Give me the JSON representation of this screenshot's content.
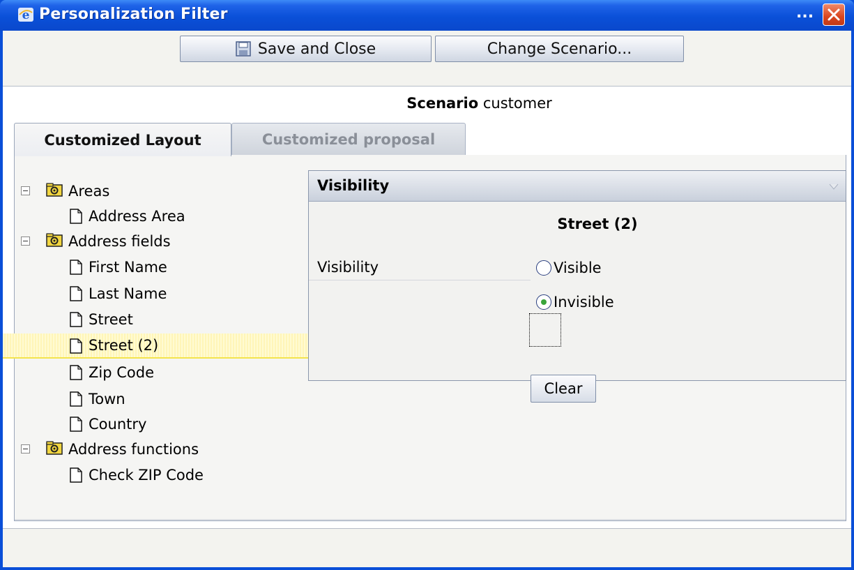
{
  "window": {
    "title": "Personalization Filter",
    "title_dots": "...",
    "colors": {
      "titlebar": "#0a50d8",
      "close": "#d9461f",
      "selection": "#fff5b8"
    }
  },
  "toolbar": {
    "save_label": "Save and Close",
    "change_label": "Change Scenario..."
  },
  "scenario": {
    "label": "Scenario",
    "value": "customer"
  },
  "tabs": [
    {
      "label": "Customized Layout",
      "active": true
    },
    {
      "label": "Customized proposal",
      "active": false
    }
  ],
  "tree": {
    "items": [
      {
        "label": "Areas",
        "type": "folder",
        "expanded": true
      },
      {
        "label": "Address Area",
        "type": "document"
      },
      {
        "label": "Address fields",
        "type": "folder",
        "expanded": true
      },
      {
        "label": "First Name",
        "type": "document"
      },
      {
        "label": "Last Name",
        "type": "document"
      },
      {
        "label": "Street",
        "type": "document"
      },
      {
        "label": "Street (2)",
        "type": "document",
        "selected": true
      },
      {
        "label": "Zip Code",
        "type": "document"
      },
      {
        "label": "Town",
        "type": "document"
      },
      {
        "label": "Country",
        "type": "document"
      },
      {
        "label": "Address functions",
        "type": "folder",
        "expanded": true
      },
      {
        "label": "Check ZIP Code",
        "type": "document"
      }
    ]
  },
  "visibility_panel": {
    "header": "Visibility",
    "field_title": "Street (2)",
    "label": "Visibility",
    "options": [
      {
        "label": "Visible",
        "checked": false
      },
      {
        "label": "Invisible",
        "checked": true
      }
    ],
    "clear_label": "Clear"
  }
}
